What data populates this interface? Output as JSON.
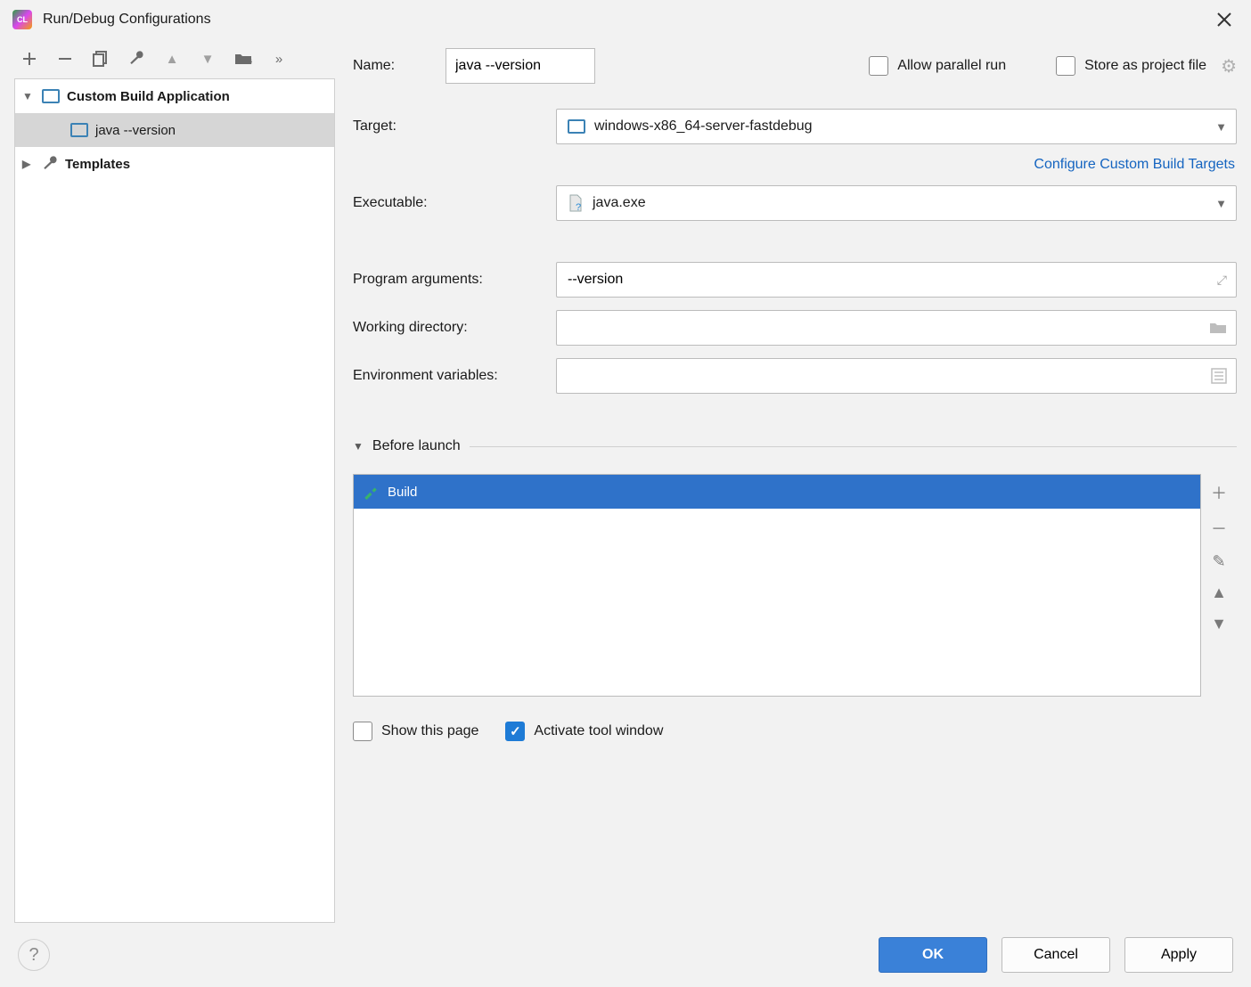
{
  "title": "Run/Debug Configurations",
  "toolbar": {
    "items": [
      "add",
      "remove",
      "copy",
      "wrench",
      "up",
      "down",
      "folder",
      "more"
    ]
  },
  "tree": {
    "group": "Custom Build Application",
    "child": "java --version",
    "templates": "Templates"
  },
  "form": {
    "name_label": "Name:",
    "name_value": "java --version",
    "allow_parallel": "Allow parallel run",
    "store_project": "Store as project file",
    "target_label": "Target:",
    "target_value": "windows-x86_64-server-fastdebug",
    "configure_link": "Configure Custom Build Targets",
    "executable_label": "Executable:",
    "executable_value": "java.exe",
    "args_label": "Program arguments:",
    "args_value": "--version",
    "workdir_label": "Working directory:",
    "workdir_value": "",
    "env_label": "Environment variables:",
    "env_value": ""
  },
  "before": {
    "header": "Before launch",
    "item": "Build"
  },
  "checks": {
    "show_page": "Show this page",
    "activate": "Activate tool window"
  },
  "buttons": {
    "ok": "OK",
    "cancel": "Cancel",
    "apply": "Apply"
  }
}
